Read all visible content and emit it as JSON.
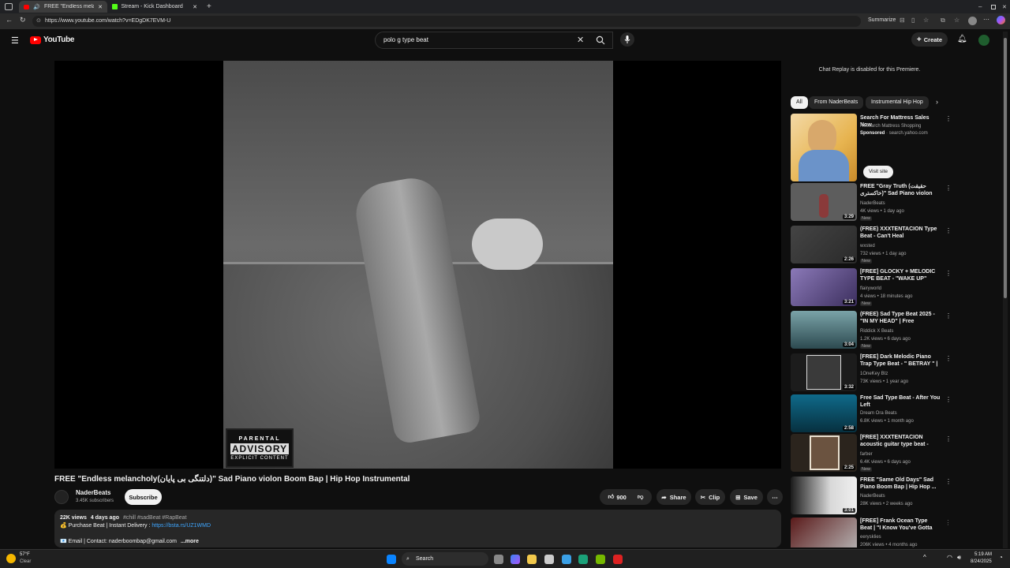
{
  "browser": {
    "tabs": [
      {
        "title": "FREE \"Endless melancholy(...",
        "active": true
      },
      {
        "title": "Stream - Kick Dashboard",
        "active": false
      }
    ],
    "url": "https://www.youtube.com/watch?v=EDgDK7EVM-U",
    "summarize_label": "Summarize"
  },
  "header": {
    "logo_text": "YouTube",
    "search_value": "polo g type beat",
    "create_label": "Create"
  },
  "player": {
    "parental_line1": "PARENTAL",
    "parental_line2": "ADVISORY",
    "parental_line3": "EXPLICIT CONTENT"
  },
  "video": {
    "title": "FREE \"Endless melancholy(دلتنگی بی پایان)\" Sad Piano violon Boom Bap | Hip Hop Instrumental",
    "channel": "NaderBeats",
    "subscribers": "3.45K subscribers",
    "subscribe_label": "Subscribe",
    "likes": "900",
    "share_label": "Share",
    "clip_label": "Clip",
    "save_label": "Save",
    "views": "22K views",
    "age": "4 days ago",
    "hashtags": "#chill #sadBeat #RapBeat",
    "desc_line1": "💰 Purchase Beat | Instant Delivery : ",
    "desc_link": "https://bsta.rs/UZ1WMD",
    "desc_line2": "📧 Email | Contact: naderboombap@gmail.com",
    "more_label": "...more"
  },
  "sidebar": {
    "chat_replay": "Chat Replay is disabled for this Premiere.",
    "chips": [
      "All",
      "From NaderBeats",
      "Instrumental Hip Hop"
    ],
    "ad": {
      "title": "Search For Mattress Sales Now",
      "advertiser": "Research Mattress Shopping",
      "sponsored": "Sponsored",
      "domain": "search.yahoo.com",
      "cta": "Visit site"
    },
    "recs": [
      {
        "title": "FREE \"Gray Truth (حقیقت خاکستری)\" Sad Piano violon Boom Bap | ...",
        "channel": "NaderBeats",
        "meta": "4K views • 1 day ago",
        "badge": "New",
        "duration": "3:29"
      },
      {
        "title": "(FREE) XXXTENTACION Type Beat - Can't Heal",
        "channel": "wxsted",
        "meta": "732 views • 1 day ago",
        "badge": "New",
        "duration": "2:26"
      },
      {
        "title": "[FREE] GLOCKY + MELODIC TYPE BEAT - \"WAKE UP\"",
        "channel": "flairyworld",
        "meta": "4 views • 18 minutes ago",
        "badge": "New",
        "duration": "3:21"
      },
      {
        "title": "(FREE) Sad Type Beat 2025 - \"IN MY HEAD\" | Free Instrumental ...",
        "channel": "Riddick X Beats",
        "meta": "1.2K views • 6 days ago",
        "badge": "New",
        "duration": "3:04"
      },
      {
        "title": "[FREE] Dark Melodic Piano Trap Type Beat - \" BETRAY \" | Melod...",
        "channel": "1OneKey Btz",
        "meta": "73K views • 1 year ago",
        "badge": "",
        "duration": "3:32"
      },
      {
        "title": "Free Sad Type Beat - After You Left",
        "channel": "Dream Ora Beats",
        "meta": "6.8K views • 1 month ago",
        "badge": "",
        "duration": "2:58"
      },
      {
        "title": "[FREE] XXXTENTACION acoustic guitar type beat - \"don...",
        "channel": "farber",
        "meta": "6.4K views • 6 days ago",
        "badge": "New",
        "duration": "2:25"
      },
      {
        "title": "FREE \"Same Old Days\" Sad Piano Boom Bap | Hip Hop ...",
        "channel": "NaderBeats",
        "meta": "28K views • 2 weeks ago",
        "badge": "",
        "duration": "3:01"
      },
      {
        "title": "[FREE] Frank Ocean Type Beat | \"I Know You've Gotta Leave\"",
        "channel": "eerysklies",
        "meta": "206K views • 4 months ago",
        "badge": "",
        "duration": ""
      }
    ]
  },
  "taskbar": {
    "weather_temp": "57°F",
    "weather_desc": "Clear",
    "search_label": "Search",
    "time": "5:19 AM",
    "date": "8/24/2025"
  },
  "colors": {
    "youtube_red": "#ff0000",
    "background": "#0f0f0f",
    "link_blue": "#3ea6ff"
  }
}
